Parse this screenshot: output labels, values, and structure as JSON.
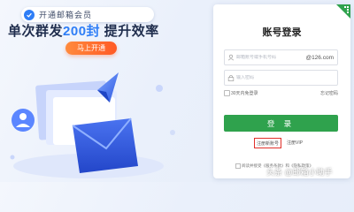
{
  "promo": {
    "pill_text": "开通邮箱会员",
    "headline_part1": "单次群发",
    "headline_highlight": "200封",
    "headline_part2": " 提升效率",
    "cta_label": "马上开通"
  },
  "login": {
    "title": "账号登录",
    "username_placeholder": "邮箱账号或手机号码",
    "domain_suffix": "@126.com",
    "password_placeholder": "输入密码",
    "remember_label": "30天内免登录",
    "forgot_label": "忘记密码",
    "submit_label": "登 录",
    "register_label": "注册新账号",
    "vip_label": "注册VIP",
    "policy_text": "阅读并接受《服务条款》和《隐私政策》"
  },
  "watermark": "头条 @邮箱小助手",
  "colors": {
    "accent_blue": "#2f7ef6",
    "login_green": "#2fa24d",
    "cta_orange": "#ff6a2d",
    "highlight_red": "#e0302a"
  },
  "icons": [
    "check-icon",
    "qr-code-icon",
    "user-icon",
    "lock-icon",
    "envelope-icon",
    "paper-plane-icon"
  ]
}
